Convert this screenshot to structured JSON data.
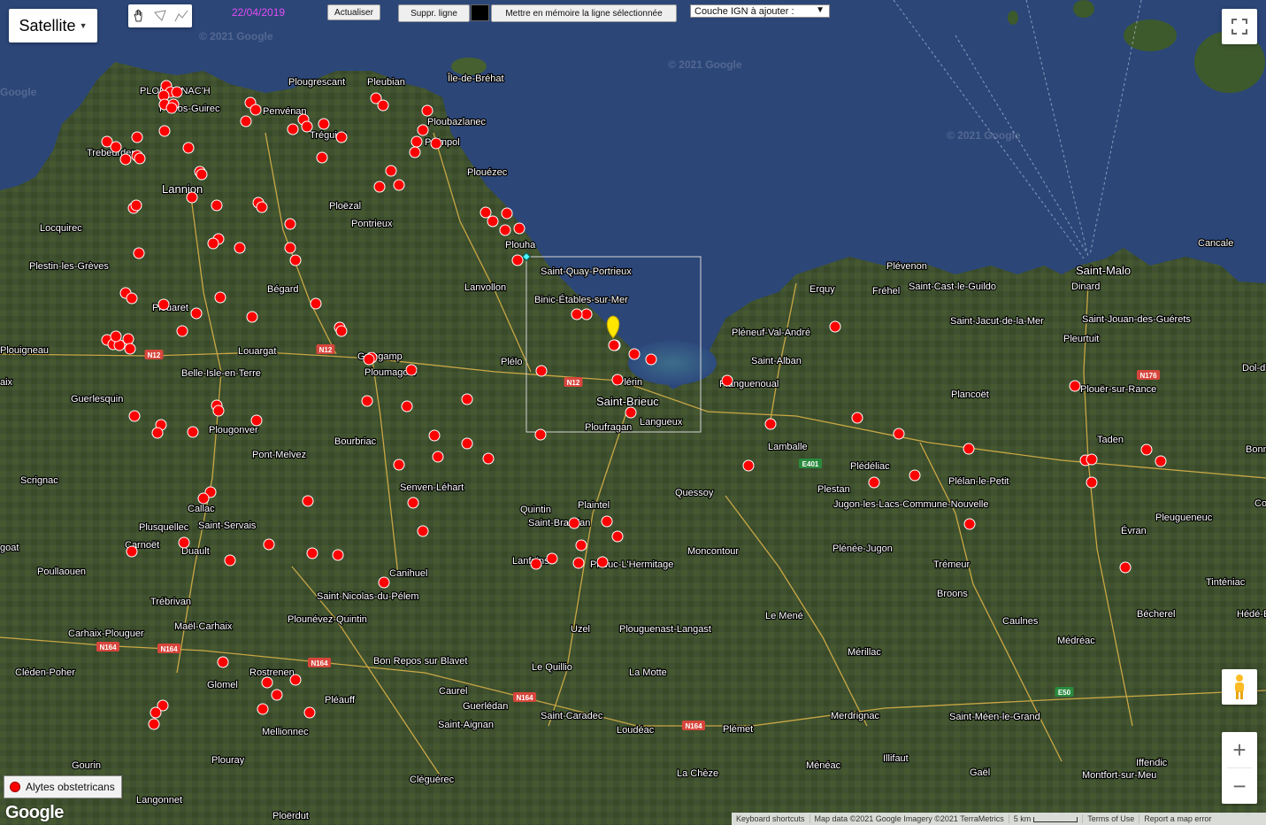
{
  "map_type": "Satellite",
  "date": "22/04/2019",
  "buttons": {
    "refresh": "Actualiser",
    "delete_line": "Suppr. ligne",
    "remember_line": "Mettre en mémoire la ligne sélectionnée"
  },
  "ign_layer_select": "Couche IGN à ajouter :",
  "legend": {
    "label": "Alytes obstetricans",
    "color": "#ff0000"
  },
  "google_logo": "Google",
  "watermarks": [
    "© 2021 Google",
    "© 2021 Google",
    "© 2021 Google",
    "Google"
  ],
  "footer": {
    "shortcuts": "Keyboard shortcuts",
    "map_data": "Map data ©2021 Google Imagery ©2021 TerraMetrics",
    "scale": "5 km",
    "terms": "Terms of Use",
    "report": "Report a map error"
  },
  "places": [
    "PLOUMANAC'H",
    "Perros-Guirec",
    "Plougrescant",
    "Pleubian",
    "Île-de-Bréhat",
    "Penvénan",
    "Tréguier",
    "Ploubazlanec",
    "Paimpol",
    "Trebeurden",
    "Lannion",
    "Plouézec",
    "Ploëzal",
    "Pontrieux",
    "Locquirec",
    "Plouha",
    "Plestin-les-Grèves",
    "Saint-Quay-Portrieux",
    "Bégard",
    "Lanvollon",
    "Binic-Étables-sur-Mer",
    "Plouaret",
    "Louargat",
    "Guingamp",
    "Ploumagoar",
    "Plélo",
    "Plouigneau",
    "Belle-Isle-en-Terre",
    "Plérin",
    "Saint-Brieuc",
    "Langueux",
    "Ploufragan",
    "Guerlesquin",
    "Plougonver",
    "Bourbriac",
    "Pont-Melvez",
    "Scrignac",
    "Senven-Léhart",
    "Callac",
    "Plusquellec",
    "Saint-Servais",
    "Carnoët",
    "Duault",
    "Poullaouen",
    "Canihuel",
    "Saint-Nicolas-du-Pélem",
    "Trébrivan",
    "Maël-Carhaix",
    "Carhaix-Plouguer",
    "Plounévez-Quintin",
    "Cléden-Poher",
    "Glomel",
    "Rostrenen",
    "Bon Repos sur Blavet",
    "Pléauff",
    "Mellionnec",
    "Gourin",
    "Plouray",
    "Langonnet",
    "Cléguérec",
    "Ploërdut",
    "Quintin",
    "Plaintel",
    "Saint-Brandan",
    "Lanfains",
    "Plœuc-L'Hermitage",
    "Moncontour",
    "Quessoy",
    "Uzel",
    "Plouguenast-Langast",
    "Le Quillio",
    "La Motte",
    "Caurel",
    "Guerlédan",
    "Saint-Aignan",
    "Saint-Caradec",
    "Loudéac",
    "Plémet",
    "La Chèze",
    "Le Mené",
    "Plévenon",
    "Erquy",
    "Fréhel",
    "Saint-Cast-le-Guildo",
    "Pléneuf-Val-André",
    "Saint-Alban",
    "Planguenoual",
    "Lamballe",
    "Plédéliac",
    "Plestan",
    "Jugon-les-Lacs-Commune-Nouvelle",
    "Plénée-Jugon",
    "Plélan-le-Petit",
    "Plancoët",
    "Saint-Jacut-de-la-Mer",
    "Saint-Malo",
    "Dinard",
    "Cancale",
    "Saint-Jouan-des-Guérets",
    "Pleurtuit",
    "Plouër-sur-Rance",
    "Taden",
    "Pleugueneuc",
    "Évran",
    "Trémeur",
    "Broons",
    "Caulnes",
    "Mérillac",
    "Médréac",
    "Bécherel",
    "Tinténiac",
    "Hédé-Bazou",
    "Merdrignac",
    "Saint-Méen-le-Grand",
    "Ménéac",
    "Illifaut",
    "Gaël",
    "Iffendic",
    "Montfort-sur-Meu",
    "Dol-d",
    "Bonn",
    "Co",
    "aix",
    "goat"
  ],
  "roads": [
    "N12",
    "N12",
    "N12",
    "N164",
    "N164",
    "N164",
    "N164",
    "N164",
    "N176",
    "E401",
    "E50"
  ],
  "observation_count": 165,
  "colors": {
    "sea": "#2e4a7d",
    "land": "#3a4a2a",
    "marker": "#ff0000",
    "selected_marker": "#ffe600"
  }
}
